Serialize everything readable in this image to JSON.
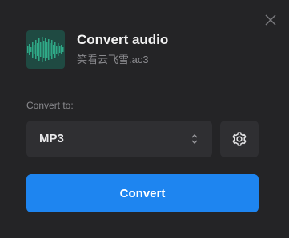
{
  "dialog": {
    "title": "Convert audio",
    "filename": "笑看云飞雪.ac3",
    "thumbnail_icon": "audio-waveform-icon",
    "close_icon": "close-icon"
  },
  "format": {
    "label": "Convert to:",
    "selected": "MP3",
    "arrow_icon": "chevron-up-down-icon",
    "settings_icon": "gear-icon"
  },
  "actions": {
    "convert_label": "Convert"
  },
  "colors": {
    "background": "#242426",
    "control": "#2f2f32",
    "accent": "#1e85f0",
    "waveform": "#2fa886",
    "thumbnail_bg": "#1f4a42"
  }
}
